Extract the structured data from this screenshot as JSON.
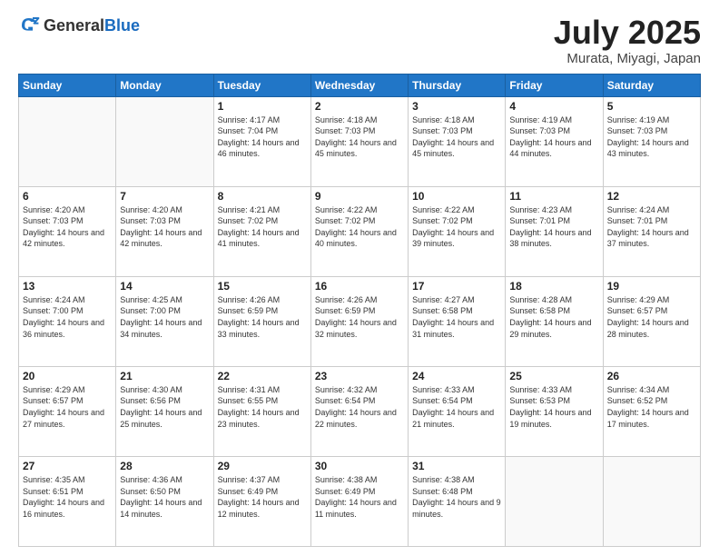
{
  "header": {
    "logo_general": "General",
    "logo_blue": "Blue",
    "month": "July 2025",
    "location": "Murata, Miyagi, Japan"
  },
  "weekdays": [
    "Sunday",
    "Monday",
    "Tuesday",
    "Wednesday",
    "Thursday",
    "Friday",
    "Saturday"
  ],
  "weeks": [
    [
      {
        "day": "",
        "empty": true
      },
      {
        "day": "",
        "empty": true
      },
      {
        "day": "1",
        "sunrise": "4:17 AM",
        "sunset": "7:04 PM",
        "daylight": "14 hours and 46 minutes."
      },
      {
        "day": "2",
        "sunrise": "4:18 AM",
        "sunset": "7:03 PM",
        "daylight": "14 hours and 45 minutes."
      },
      {
        "day": "3",
        "sunrise": "4:18 AM",
        "sunset": "7:03 PM",
        "daylight": "14 hours and 45 minutes."
      },
      {
        "day": "4",
        "sunrise": "4:19 AM",
        "sunset": "7:03 PM",
        "daylight": "14 hours and 44 minutes."
      },
      {
        "day": "5",
        "sunrise": "4:19 AM",
        "sunset": "7:03 PM",
        "daylight": "14 hours and 43 minutes."
      }
    ],
    [
      {
        "day": "6",
        "sunrise": "4:20 AM",
        "sunset": "7:03 PM",
        "daylight": "14 hours and 42 minutes."
      },
      {
        "day": "7",
        "sunrise": "4:20 AM",
        "sunset": "7:03 PM",
        "daylight": "14 hours and 42 minutes."
      },
      {
        "day": "8",
        "sunrise": "4:21 AM",
        "sunset": "7:02 PM",
        "daylight": "14 hours and 41 minutes."
      },
      {
        "day": "9",
        "sunrise": "4:22 AM",
        "sunset": "7:02 PM",
        "daylight": "14 hours and 40 minutes."
      },
      {
        "day": "10",
        "sunrise": "4:22 AM",
        "sunset": "7:02 PM",
        "daylight": "14 hours and 39 minutes."
      },
      {
        "day": "11",
        "sunrise": "4:23 AM",
        "sunset": "7:01 PM",
        "daylight": "14 hours and 38 minutes."
      },
      {
        "day": "12",
        "sunrise": "4:24 AM",
        "sunset": "7:01 PM",
        "daylight": "14 hours and 37 minutes."
      }
    ],
    [
      {
        "day": "13",
        "sunrise": "4:24 AM",
        "sunset": "7:00 PM",
        "daylight": "14 hours and 36 minutes."
      },
      {
        "day": "14",
        "sunrise": "4:25 AM",
        "sunset": "7:00 PM",
        "daylight": "14 hours and 34 minutes."
      },
      {
        "day": "15",
        "sunrise": "4:26 AM",
        "sunset": "6:59 PM",
        "daylight": "14 hours and 33 minutes."
      },
      {
        "day": "16",
        "sunrise": "4:26 AM",
        "sunset": "6:59 PM",
        "daylight": "14 hours and 32 minutes."
      },
      {
        "day": "17",
        "sunrise": "4:27 AM",
        "sunset": "6:58 PM",
        "daylight": "14 hours and 31 minutes."
      },
      {
        "day": "18",
        "sunrise": "4:28 AM",
        "sunset": "6:58 PM",
        "daylight": "14 hours and 29 minutes."
      },
      {
        "day": "19",
        "sunrise": "4:29 AM",
        "sunset": "6:57 PM",
        "daylight": "14 hours and 28 minutes."
      }
    ],
    [
      {
        "day": "20",
        "sunrise": "4:29 AM",
        "sunset": "6:57 PM",
        "daylight": "14 hours and 27 minutes."
      },
      {
        "day": "21",
        "sunrise": "4:30 AM",
        "sunset": "6:56 PM",
        "daylight": "14 hours and 25 minutes."
      },
      {
        "day": "22",
        "sunrise": "4:31 AM",
        "sunset": "6:55 PM",
        "daylight": "14 hours and 23 minutes."
      },
      {
        "day": "23",
        "sunrise": "4:32 AM",
        "sunset": "6:54 PM",
        "daylight": "14 hours and 22 minutes."
      },
      {
        "day": "24",
        "sunrise": "4:33 AM",
        "sunset": "6:54 PM",
        "daylight": "14 hours and 21 minutes."
      },
      {
        "day": "25",
        "sunrise": "4:33 AM",
        "sunset": "6:53 PM",
        "daylight": "14 hours and 19 minutes."
      },
      {
        "day": "26",
        "sunrise": "4:34 AM",
        "sunset": "6:52 PM",
        "daylight": "14 hours and 17 minutes."
      }
    ],
    [
      {
        "day": "27",
        "sunrise": "4:35 AM",
        "sunset": "6:51 PM",
        "daylight": "14 hours and 16 minutes."
      },
      {
        "day": "28",
        "sunrise": "4:36 AM",
        "sunset": "6:50 PM",
        "daylight": "14 hours and 14 minutes."
      },
      {
        "day": "29",
        "sunrise": "4:37 AM",
        "sunset": "6:49 PM",
        "daylight": "14 hours and 12 minutes."
      },
      {
        "day": "30",
        "sunrise": "4:38 AM",
        "sunset": "6:49 PM",
        "daylight": "14 hours and 11 minutes."
      },
      {
        "day": "31",
        "sunrise": "4:38 AM",
        "sunset": "6:48 PM",
        "daylight": "14 hours and 9 minutes."
      },
      {
        "day": "",
        "empty": true
      },
      {
        "day": "",
        "empty": true
      }
    ]
  ]
}
